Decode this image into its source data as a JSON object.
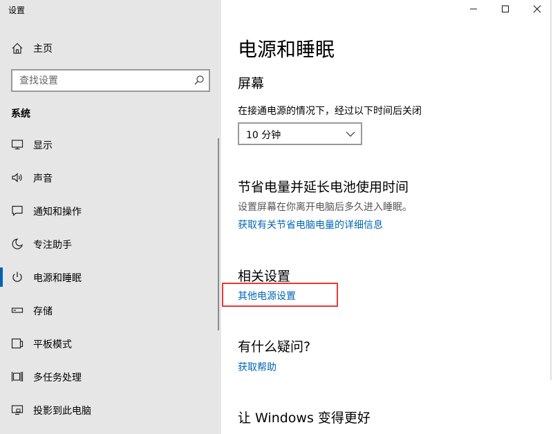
{
  "window": {
    "title": "设置",
    "controls": [
      "minimize",
      "maximize",
      "close"
    ]
  },
  "sidebar": {
    "home_label": "主页",
    "search": {
      "placeholder": "查找设置",
      "value": ""
    },
    "section": "系统",
    "items": [
      {
        "label": "显示",
        "icon": "display-icon",
        "active": false
      },
      {
        "label": "声音",
        "icon": "speaker-icon",
        "active": false
      },
      {
        "label": "通知和操作",
        "icon": "notification-icon",
        "active": false
      },
      {
        "label": "专注助手",
        "icon": "moon-icon",
        "active": false
      },
      {
        "label": "电源和睡眠",
        "icon": "power-icon",
        "active": true
      },
      {
        "label": "存储",
        "icon": "storage-icon",
        "active": false
      },
      {
        "label": "平板模式",
        "icon": "tablet-icon",
        "active": false
      },
      {
        "label": "多任务处理",
        "icon": "multitask-icon",
        "active": false
      },
      {
        "label": "投影到此电脑",
        "icon": "project-icon",
        "active": false
      }
    ]
  },
  "main": {
    "title": "电源和睡眠",
    "screen": {
      "heading": "屏幕",
      "description": "在接通电源的情况下，经过以下时间后关闭",
      "dropdown_value": "10 分钟"
    },
    "battery": {
      "heading": "节省电量并延长电池使用时间",
      "description": "设置屏幕在你离开电脑后多久进入睡眠。",
      "link": "获取有关节省电脑电量的详细信息"
    },
    "related": {
      "heading": "相关设置",
      "link": "其他电源设置"
    },
    "help": {
      "heading": "有什么疑问?",
      "link": "获取帮助"
    },
    "better": {
      "heading": "让 Windows 变得更好"
    }
  },
  "colors": {
    "accent": "#0063b1",
    "link": "#0066b4",
    "highlight": "#e53935",
    "sidebar_bg": "#e6e6e6"
  }
}
